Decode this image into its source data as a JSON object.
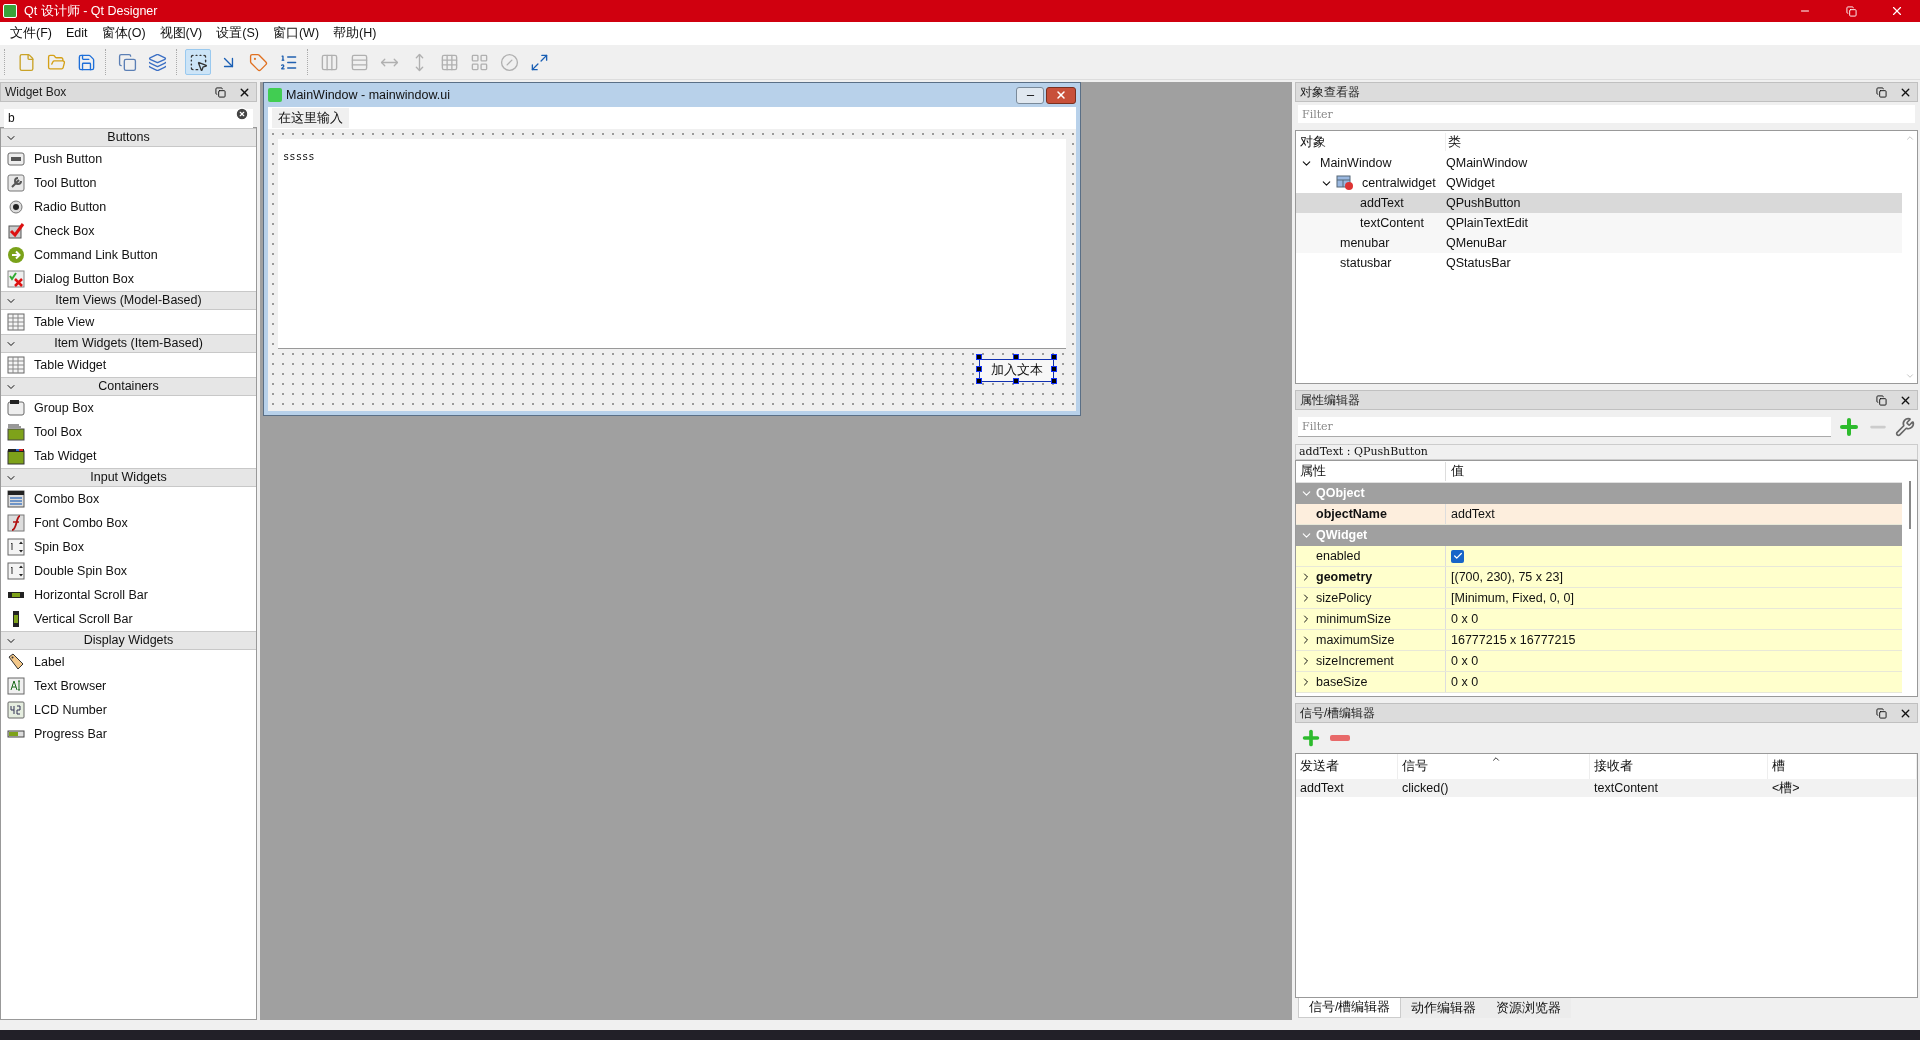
{
  "window": {
    "title": "Qt 设计师 - Qt Designer"
  },
  "menu": [
    "文件(F)",
    "Edit",
    "窗体(O)",
    "视图(V)",
    "设置(S)",
    "窗口(W)",
    "帮助(H)"
  ],
  "toolbar": [
    [
      {
        "kind": "new",
        "selected": false,
        "disabled": false
      },
      {
        "kind": "open",
        "selected": false,
        "disabled": false
      },
      {
        "kind": "save",
        "selected": false,
        "disabled": false
      }
    ],
    [
      {
        "kind": "send-back",
        "selected": false,
        "disabled": false
      },
      {
        "kind": "bring-front",
        "selected": false,
        "disabled": false
      }
    ],
    [
      {
        "kind": "edit-widgets",
        "selected": true,
        "disabled": false
      },
      {
        "kind": "edit-signals",
        "selected": false,
        "disabled": false
      },
      {
        "kind": "edit-buddies",
        "selected": false,
        "disabled": false
      },
      {
        "kind": "edit-tab-order",
        "selected": false,
        "disabled": false
      }
    ],
    [
      {
        "kind": "layout-h",
        "selected": false,
        "disabled": true
      },
      {
        "kind": "layout-v",
        "selected": false,
        "disabled": true
      },
      {
        "kind": "split-h",
        "selected": false,
        "disabled": true
      },
      {
        "kind": "split-v",
        "selected": false,
        "disabled": true
      },
      {
        "kind": "grid",
        "selected": false,
        "disabled": true
      },
      {
        "kind": "form",
        "selected": false,
        "disabled": true
      },
      {
        "kind": "break",
        "selected": false,
        "disabled": true
      },
      {
        "kind": "adjust",
        "selected": false,
        "disabled": false
      }
    ]
  ],
  "widget_box": {
    "title": "Widget Box",
    "filter": "b",
    "categories": [
      {
        "label": "Buttons",
        "expanded": true,
        "items": [
          {
            "label": "Push Button",
            "kind": "push"
          },
          {
            "label": "Tool Button",
            "kind": "tool"
          },
          {
            "label": "Radio Button",
            "kind": "radio"
          },
          {
            "label": "Check Box",
            "kind": "check"
          },
          {
            "label": "Command Link Button",
            "kind": "link"
          },
          {
            "label": "Dialog Button Box",
            "kind": "dialog"
          }
        ]
      },
      {
        "label": "Item Views (Model-Based)",
        "expanded": true,
        "items": [
          {
            "label": "Table View",
            "kind": "table"
          }
        ]
      },
      {
        "label": "Item Widgets (Item-Based)",
        "expanded": true,
        "items": [
          {
            "label": "Table Widget",
            "kind": "table"
          }
        ]
      },
      {
        "label": "Containers",
        "expanded": true,
        "items": [
          {
            "label": "Group Box",
            "kind": "group"
          },
          {
            "label": "Tool Box",
            "kind": "toolbox"
          },
          {
            "label": "Tab Widget",
            "kind": "tab"
          }
        ]
      },
      {
        "label": "Input Widgets",
        "expanded": true,
        "items": [
          {
            "label": "Combo Box",
            "kind": "combo"
          },
          {
            "label": "Font Combo Box",
            "kind": "fontcombo"
          },
          {
            "label": "Spin Box",
            "kind": "spin"
          },
          {
            "label": "Double Spin Box",
            "kind": "spin"
          },
          {
            "label": "Horizontal Scroll Bar",
            "kind": "hscroll"
          },
          {
            "label": "Vertical Scroll Bar",
            "kind": "vscroll"
          }
        ]
      },
      {
        "label": "Display Widgets",
        "expanded": true,
        "items": [
          {
            "label": "Label",
            "kind": "label"
          },
          {
            "label": "Text Browser",
            "kind": "textbrowser"
          },
          {
            "label": "LCD Number",
            "kind": "lcd"
          },
          {
            "label": "Progress Bar",
            "kind": "progress"
          }
        ]
      }
    ]
  },
  "form": {
    "title": "MainWindow - mainwindow.ui",
    "menu_placeholder": "在这里输入",
    "text": "sssss",
    "button": "加入文本",
    "button_selected": true
  },
  "object_inspector": {
    "title": "对象查看器",
    "filter_placeholder": "Filter",
    "columns": [
      "对象",
      "类"
    ],
    "tree": [
      {
        "name": "MainWindow",
        "class": "QMainWindow",
        "selected": false,
        "expanded": true,
        "children": [
          {
            "name": "centralwidget",
            "class": "QWidget",
            "selected": false,
            "expanded": true,
            "children": [
              {
                "name": "addText",
                "class": "QPushButton",
                "selected": true
              },
              {
                "name": "textContent",
                "class": "QPlainTextEdit",
                "selected": false
              }
            ]
          },
          {
            "name": "menubar",
            "class": "QMenuBar",
            "selected": false
          },
          {
            "name": "statusbar",
            "class": "QStatusBar",
            "selected": false
          }
        ]
      }
    ]
  },
  "property_editor": {
    "title": "属性编辑器",
    "filter_placeholder": "Filter",
    "object_label": "addText : QPushButton",
    "columns": [
      "属性",
      "值"
    ],
    "groups": [
      {
        "label": "QObject",
        "expanded": true,
        "color": "#fdeedd",
        "properties": [
          {
            "name": "objectName",
            "value": "addText",
            "changed": true,
            "expandable": false,
            "kind": "text"
          }
        ]
      },
      {
        "label": "QWidget",
        "expanded": true,
        "color": "#ffffcc",
        "properties": [
          {
            "name": "enabled",
            "kind": "checkbox",
            "checked": true,
            "changed": false,
            "expandable": false
          },
          {
            "name": "geometry",
            "value": "[(700, 230), 75 x 23]",
            "changed": true,
            "expandable": true,
            "kind": "text"
          },
          {
            "name": "sizePolicy",
            "value": "[Minimum, Fixed, 0, 0]",
            "changed": false,
            "expandable": true,
            "kind": "text"
          },
          {
            "name": "minimumSize",
            "value": "0 x 0",
            "changed": false,
            "expandable": true,
            "kind": "text"
          },
          {
            "name": "maximumSize",
            "value": "16777215 x 16777215",
            "changed": false,
            "expandable": true,
            "kind": "text"
          },
          {
            "name": "sizeIncrement",
            "value": "0 x 0",
            "changed": false,
            "expandable": true,
            "kind": "text"
          },
          {
            "name": "baseSize",
            "value": "0 x 0",
            "changed": false,
            "expandable": true,
            "kind": "text"
          }
        ]
      }
    ]
  },
  "signal_slot_editor": {
    "title": "信号/槽编辑器",
    "columns": [
      "发送者",
      "信号",
      "接收者",
      "槽"
    ],
    "rows": [
      [
        "addText",
        "clicked()",
        "textContent",
        "<槽>"
      ]
    ]
  },
  "bottom_tabs": [
    {
      "label": "信号/槽编辑器",
      "selected": true
    },
    {
      "label": "动作编辑器",
      "selected": false
    },
    {
      "label": "资源浏览器",
      "selected": false
    }
  ]
}
